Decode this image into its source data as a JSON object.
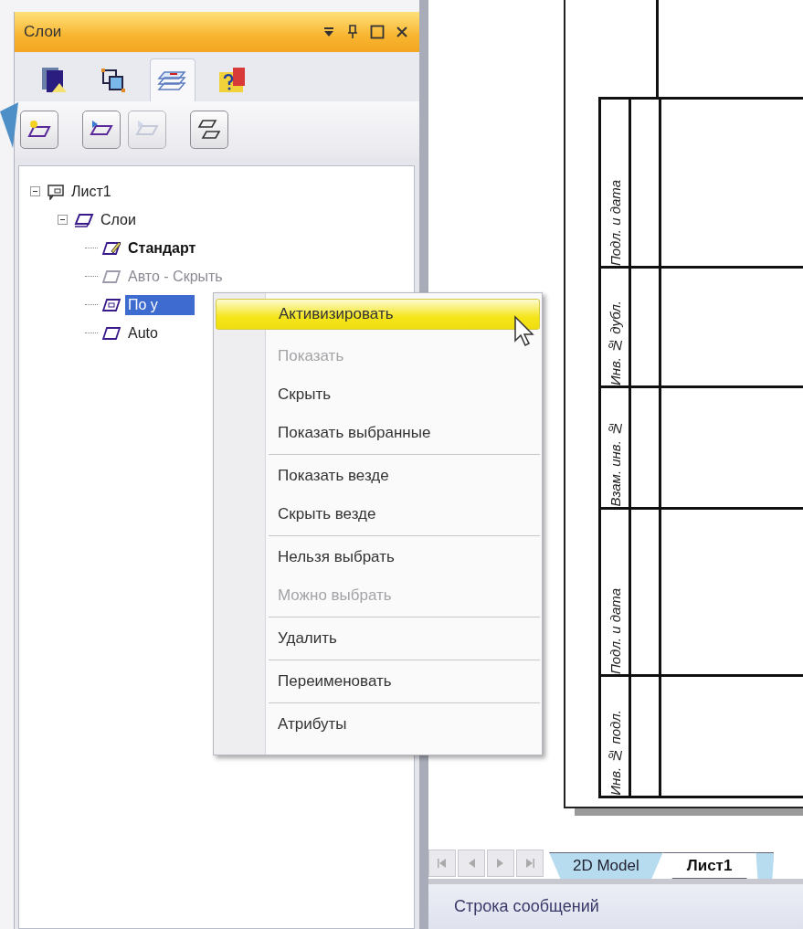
{
  "panel": {
    "title": "Слои"
  },
  "panel_tabs": [
    {
      "selected": false
    },
    {
      "selected": false
    },
    {
      "selected": true
    },
    {
      "selected": false
    }
  ],
  "toolbar": [
    {
      "disabled": false
    },
    {
      "disabled": false
    },
    {
      "disabled": true
    },
    {
      "disabled": false
    }
  ],
  "tree": [
    {
      "label": "Лист1",
      "kind": "sheet",
      "expanded": true,
      "selected": false,
      "children": [
        {
          "label": "Слои",
          "kind": "group",
          "expanded": true,
          "selected": false,
          "children": [
            {
              "label": "Стандарт",
              "kind": "layer",
              "active": true,
              "hidden": false,
              "selected": false
            },
            {
              "label": "Авто - Скрыть",
              "kind": "layer",
              "active": false,
              "hidden": true,
              "selected": false
            },
            {
              "label": "По у",
              "kind": "layer",
              "active": false,
              "hidden": false,
              "selected": true
            },
            {
              "label": "Auto",
              "kind": "layer",
              "active": false,
              "hidden": false,
              "selected": false
            }
          ]
        }
      ]
    }
  ],
  "context_menu": [
    {
      "label": "Активизировать",
      "selected": true,
      "disabled": false,
      "separator_before": false
    },
    {
      "label": "Показать",
      "selected": false,
      "disabled": true,
      "separator_before": false
    },
    {
      "label": "Скрыть",
      "selected": false,
      "disabled": false,
      "separator_before": false
    },
    {
      "label": "Показать выбранные",
      "selected": false,
      "disabled": false,
      "separator_before": false
    },
    {
      "label": "Показать везде",
      "selected": false,
      "disabled": false,
      "separator_before": true
    },
    {
      "label": "Скрыть везде",
      "selected": false,
      "disabled": false,
      "separator_before": false
    },
    {
      "label": "Нельзя выбрать",
      "selected": false,
      "disabled": false,
      "separator_before": true
    },
    {
      "label": "Можно выбрать",
      "selected": false,
      "disabled": true,
      "separator_before": false
    },
    {
      "label": "Удалить",
      "selected": false,
      "disabled": false,
      "separator_before": true
    },
    {
      "label": "Переименовать",
      "selected": false,
      "disabled": false,
      "separator_before": true
    },
    {
      "label": "Атрибуты",
      "selected": false,
      "disabled": false,
      "separator_before": true
    }
  ],
  "drawing": {
    "stamp_cells": [
      "Подл. и дата",
      "Инв. № дубл.",
      "Взам. инв. №",
      "Подл. и дата",
      "Инв. № подл."
    ]
  },
  "sheet_tabs": [
    {
      "label": "2D Model",
      "selected": false
    },
    {
      "label": "Лист1",
      "selected": true
    }
  ],
  "status_bar": {
    "text": "Строка сообщений"
  }
}
